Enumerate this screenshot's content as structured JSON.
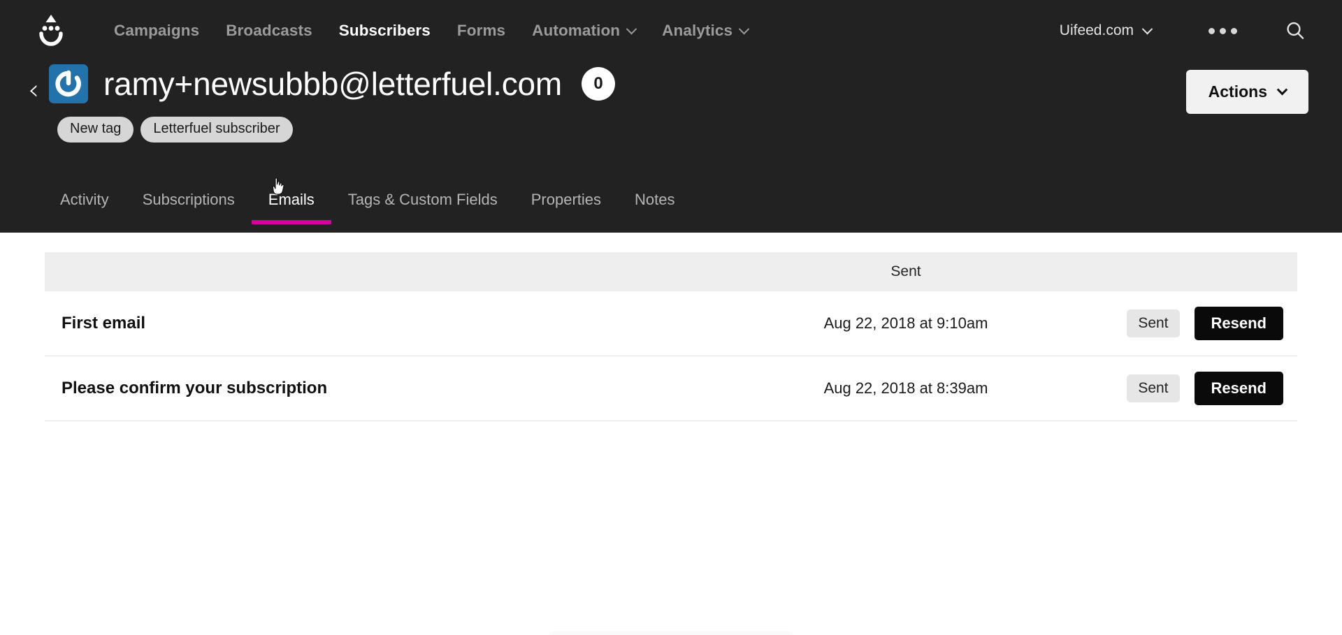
{
  "topnav": {
    "logo_icon": "convertkit-smiley-logo",
    "links": [
      {
        "label": "Campaigns",
        "active": false,
        "has_caret": false
      },
      {
        "label": "Broadcasts",
        "active": false,
        "has_caret": false
      },
      {
        "label": "Subscribers",
        "active": true,
        "has_caret": false
      },
      {
        "label": "Forms",
        "active": false,
        "has_caret": false
      },
      {
        "label": "Automation",
        "active": false,
        "has_caret": true
      },
      {
        "label": "Analytics",
        "active": false,
        "has_caret": true
      }
    ],
    "account_label": "Uifeed.com",
    "more_icon": "ellipsis-icon",
    "search_icon": "search-icon"
  },
  "subscriber": {
    "back_icon": "back-chevron-icon",
    "avatar_icon": "gravatar-default-avatar",
    "email": "ramy+newsubbb@letterfuel.com",
    "count_badge": "0",
    "tags": [
      {
        "label": "New tag"
      },
      {
        "label": "Letterfuel subscriber"
      }
    ],
    "actions_label": "Actions",
    "actions_caret_icon": "chevron-down-icon"
  },
  "tabs": [
    {
      "label": "Activity",
      "active": false
    },
    {
      "label": "Subscriptions",
      "active": false
    },
    {
      "label": "Emails",
      "active": true
    },
    {
      "label": "Tags & Custom Fields",
      "active": false
    },
    {
      "label": "Properties",
      "active": false
    },
    {
      "label": "Notes",
      "active": false
    }
  ],
  "emails_table": {
    "columns": {
      "name": "",
      "sent": "Sent",
      "actions": ""
    },
    "rows": [
      {
        "name": "First email",
        "sent": "Aug 22, 2018 at 9:10am",
        "status": "Sent",
        "action_label": "Resend"
      },
      {
        "name": "Please confirm your subscription",
        "sent": "Aug 22, 2018 at 8:39am",
        "status": "Sent",
        "action_label": "Resend"
      }
    ]
  },
  "colors": {
    "header_bg": "#222222",
    "accent_magenta": "#d900a0",
    "avatar_blue": "#2272ab",
    "tag_gray": "#d6d6d6",
    "table_header_gray": "#eeeeee",
    "button_black": "#0a0a0a"
  },
  "cursor": {
    "icon": "pointing-hand-cursor"
  }
}
